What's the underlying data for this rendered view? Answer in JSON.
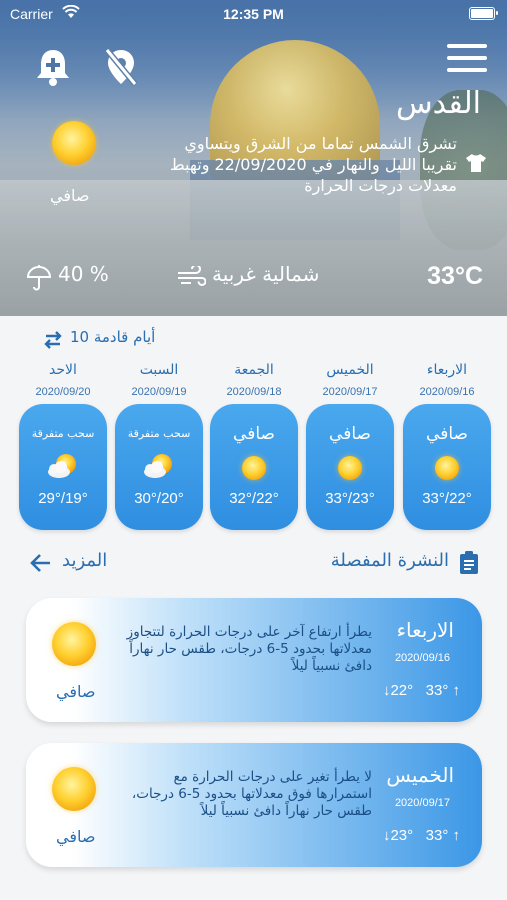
{
  "status_bar": {
    "carrier": "Carrier",
    "time": "12:35 PM"
  },
  "hero": {
    "city": "القدس",
    "description": "تشرق الشمس تماما من الشرق ويتساوي تقريبا الليل والنهار في 22/09/2020 وتهبط معدلات درجات الحرارة",
    "condition": "صافي",
    "temperature": "33°C",
    "wind": "شمالية غربية",
    "rain_chance": "40 %"
  },
  "next_days": {
    "label": "10 أيام قادمة",
    "days": [
      {
        "name": "الاربعاء",
        "date": "2020/09/16",
        "condition": "صافي",
        "icon": "sun-icon",
        "range": "33°/22°"
      },
      {
        "name": "الخميس",
        "date": "2020/09/17",
        "condition": "صافي",
        "icon": "sun-icon",
        "range": "33°/23°"
      },
      {
        "name": "الجمعة",
        "date": "2020/09/18",
        "condition": "صافي",
        "icon": "sun-icon",
        "range": "32°/22°"
      },
      {
        "name": "السبت",
        "date": "2020/09/19",
        "condition": "سحب متفرقة",
        "icon": "cloud-sun-icon",
        "range": "30°/20°"
      },
      {
        "name": "الاحد",
        "date": "2020/09/20",
        "condition": "سحب متفرقة",
        "icon": "cloud-sun-icon",
        "range": "29°/19°"
      }
    ]
  },
  "detail": {
    "title": "النشرة المفصلة",
    "more": "المزيد"
  },
  "forecasts": [
    {
      "day": "الاربعاء",
      "date": "2020/09/16",
      "high": "33°",
      "low": "22°",
      "condition": "صافي",
      "text": "يطرأ ارتفاع آخر على درجات الحرارة لتتجاوز معدلاتها بحدود 5-6 درجات، طقس حار نهاراً دافئ نسبياً ليلاً"
    },
    {
      "day": "الخميس",
      "date": "2020/09/17",
      "high": "33°",
      "low": "23°",
      "condition": "صافي",
      "text": "لا يطرأ تغير على درجات الحرارة مع استمرارها فوق معدلاتها بحدود 5-6 درجات، طقس حار نهاراً دافئ نسبياً ليلاً"
    }
  ],
  "colors": {
    "accent": "#2a6eb0",
    "card_blue": "#3b97e6"
  }
}
